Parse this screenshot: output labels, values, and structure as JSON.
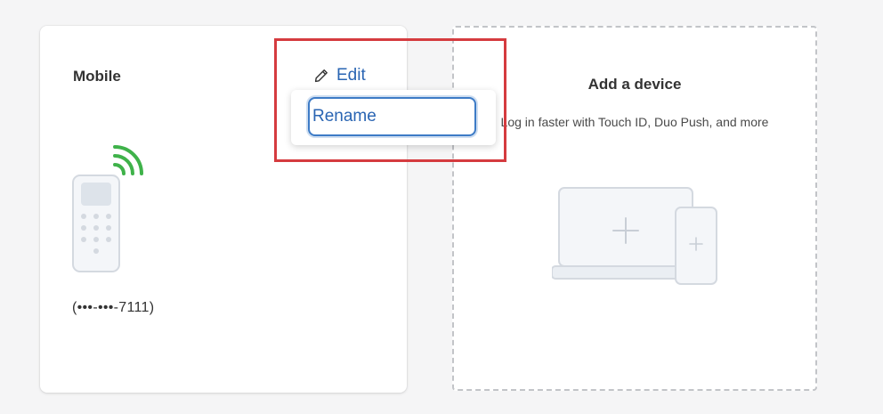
{
  "device_card": {
    "title": "Mobile",
    "edit_label": "Edit",
    "phone_number": "(•••-•••-7111)"
  },
  "edit_menu": {
    "items": [
      {
        "label": "Rename"
      }
    ]
  },
  "add_device": {
    "title": "Add a device",
    "description": "Log in faster with Touch ID, Duo Push, and more"
  },
  "colors": {
    "link_blue": "#2a65b3",
    "focus_ring": "#3d7bc6",
    "highlight_red": "#d53b3f",
    "signal_green": "#3fb24a",
    "illustration_gray": "#dde3ea"
  },
  "icons": {
    "edit": "pencil-icon",
    "device": "phone-icon",
    "add": "plus-icon"
  }
}
